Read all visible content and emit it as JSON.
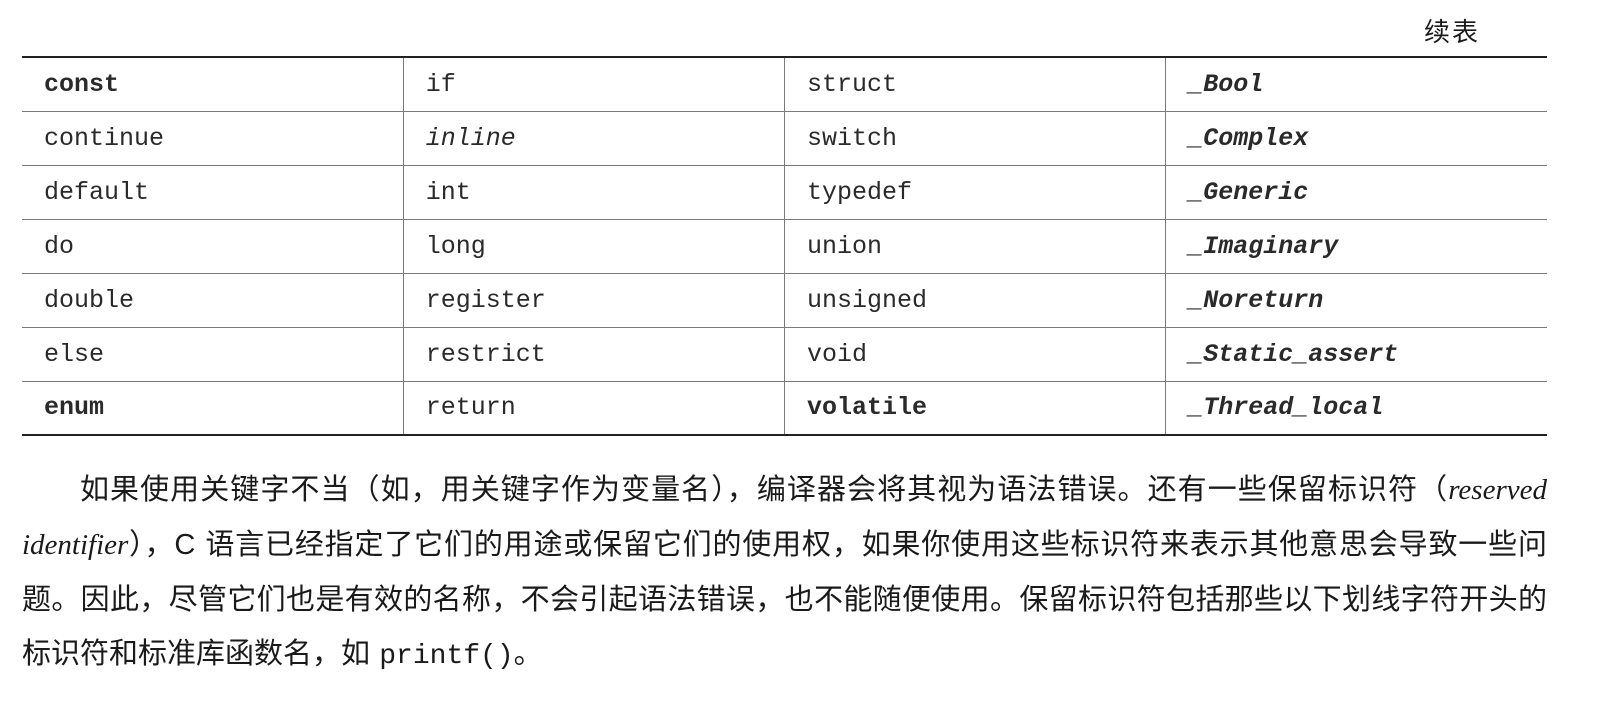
{
  "header": {
    "continued_label": "续表"
  },
  "keyword_table": {
    "rows": [
      [
        "const",
        "if",
        "struct",
        "_Bool"
      ],
      [
        "continue",
        "inline",
        "switch",
        "_Complex"
      ],
      [
        "default",
        "int",
        "typedef",
        "_Generic"
      ],
      [
        "do",
        "long",
        "union",
        "_Imaginary"
      ],
      [
        "double",
        "register",
        "unsigned",
        "_Noreturn"
      ],
      [
        "else",
        "restrict",
        "void",
        "_Static_assert"
      ],
      [
        "enum",
        "return",
        "volatile",
        "_Thread_local"
      ]
    ]
  },
  "paragraph": {
    "part1": "如果使用关键字不当（如，用关键字作为变量名），编译器会将其视为语法错误。还有一些保留标识符（",
    "term": "reserved identifier",
    "part2": "），",
    "lang": "C",
    "part3": " 语言已经指定了它们的用途或保留它们的使用权，如果你使用这些标识符来表示其他意思会导致一些问题。因此，尽管它们也是有效的名称，不会引起语法错误，也不能随便使用。保留标识符包括那些以下划线字符开头的标识符和标准库函数名，如 ",
    "code": "printf()",
    "part4": "。"
  }
}
